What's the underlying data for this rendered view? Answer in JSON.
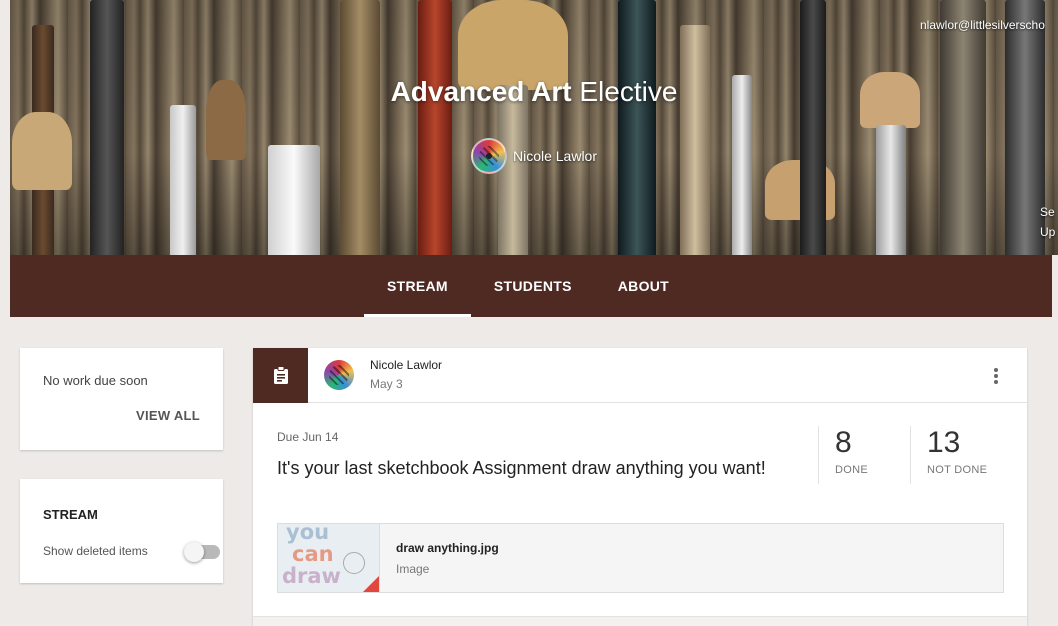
{
  "banner": {
    "title_bold": "Advanced Art",
    "title_rest": "Elective",
    "teacher_name": "Nicole Lawlor",
    "account_email": "nlawlor@littlesilverscho",
    "side_text_line1": "Se",
    "side_text_line2": "Up"
  },
  "tabs": [
    {
      "label": "STREAM",
      "active": true
    },
    {
      "label": "STUDENTS",
      "active": false
    },
    {
      "label": "ABOUT",
      "active": false
    }
  ],
  "due_card": {
    "text": "No work due soon",
    "link": "VIEW ALL"
  },
  "stream_card": {
    "heading": "STREAM",
    "toggle_label": "Show deleted items",
    "toggle_on": false
  },
  "post": {
    "author": "Nicole Lawlor",
    "date": "May 3",
    "badge_icon": "assignment-icon",
    "due": "Due Jun 14",
    "title": "It's your last sketchbook Assignment draw anything you want!",
    "done_count": "8",
    "done_label": "DONE",
    "not_done_count": "13",
    "not_done_label": "NOT DONE",
    "attachment": {
      "name": "draw anything.jpg",
      "type": "Image",
      "thumb_words": [
        "you",
        "can",
        "draw"
      ]
    }
  },
  "colors": {
    "brand": "#4e2a23",
    "page_bg": "#eeeae7",
    "card_bg": "#ffffff"
  }
}
